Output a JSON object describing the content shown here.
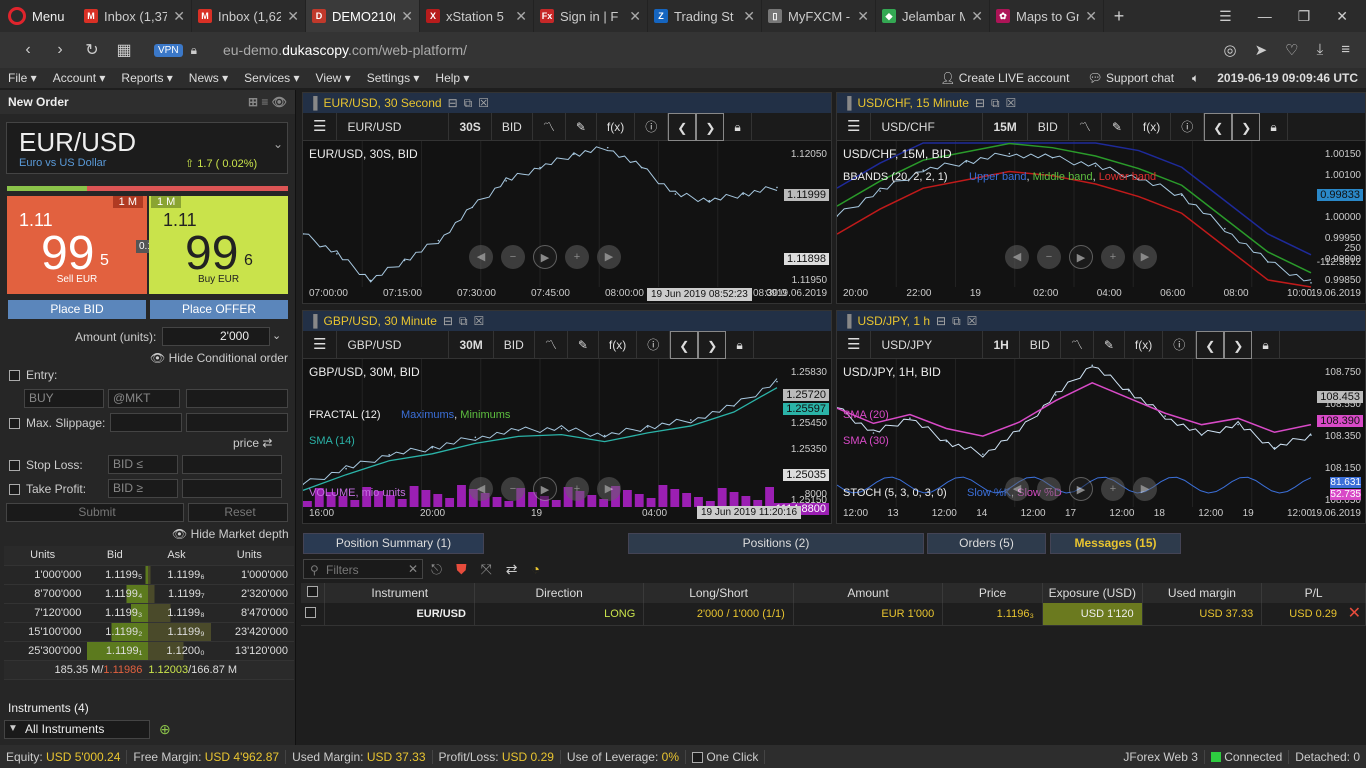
{
  "browser": {
    "menu_label": "Menu",
    "tabs": [
      {
        "title": "Inbox (1,37",
        "fav": "M",
        "color": "#d93025"
      },
      {
        "title": "Inbox (1,62",
        "fav": "M",
        "color": "#d93025"
      },
      {
        "title": "DEMO210(",
        "fav": "D",
        "color": "#c0392b"
      },
      {
        "title": "xStation 5",
        "fav": "X",
        "color": "#b71c1c"
      },
      {
        "title": "Sign in | F",
        "fav": "Fx",
        "color": "#c62828"
      },
      {
        "title": "Trading St",
        "fav": "Z",
        "color": "#1565c0"
      },
      {
        "title": "MyFXCM -",
        "fav": "▯",
        "color": "#777"
      },
      {
        "title": "Jelambar M",
        "fav": "◆",
        "color": "#34a853"
      },
      {
        "title": "Maps to Gr",
        "fav": "✿",
        "color": "#ad1457"
      }
    ],
    "vpn": "VPN",
    "url_prefix": "eu-demo.",
    "url_domain": "dukascopy",
    "url_suffix": ".com/web-platform/"
  },
  "platform_menu": {
    "items": [
      "File ▾",
      "Account ▾",
      "Reports ▾",
      "News ▾",
      "Services ▾",
      "View ▾",
      "Settings ▾",
      "Help ▾"
    ],
    "create_live": "Create LIVE account",
    "support_chat": "Support chat",
    "datetime": "2019-06-19 09:09:46 UTC"
  },
  "new_order": {
    "title": "New Order",
    "symbol": "EUR/USD",
    "symbol_desc": "Euro vs US Dollar",
    "change": "1.7 ( 0.02%)",
    "sell": {
      "big_prefix": "1.11",
      "big": "99",
      "pip": "5",
      "label": "Sell EUR",
      "amount": "1 M"
    },
    "buy": {
      "big_prefix": "1.11",
      "big": "99",
      "pip": "6",
      "label": "Buy EUR",
      "amount": "1 M"
    },
    "spread": "0.1",
    "place_bid": "Place BID",
    "place_offer": "Place OFFER",
    "amount_label": "Amount (units):",
    "amount_value": "2'000",
    "hide_conditional": "Hide Conditional order",
    "entry_label": "Entry:",
    "entry_side": "BUY",
    "entry_mkt": "@MKT",
    "max_slippage": "Max. Slippage:",
    "price_label": "price",
    "stop_loss": "Stop Loss:",
    "stop_loss_sel": "BID ≤",
    "take_profit": "Take Profit:",
    "take_profit_sel": "BID ≥",
    "submit": "Submit",
    "reset": "Reset",
    "hide_depth": "Hide Market depth"
  },
  "market_depth": {
    "headers": [
      "Units",
      "Bid",
      "Ask",
      "Units"
    ],
    "rows": [
      [
        "1'000'000",
        "1.1199₅",
        "1.1199₆",
        "1'000'000"
      ],
      [
        "8'700'000",
        "1.1199₄",
        "1.1199₇",
        "2'320'000"
      ],
      [
        "7'120'000",
        "1.1199₃",
        "1.1199₈",
        "8'470'000"
      ],
      [
        "15'100'000",
        "1.1199₂",
        "1.1199₉",
        "23'420'000"
      ],
      [
        "25'300'000",
        "1.1199₁",
        "1.1200₀",
        "13'120'000"
      ]
    ],
    "bid_levels": [
      0.04,
      0.35,
      0.28,
      0.6,
      1.0
    ],
    "ask_levels": [
      0.04,
      0.1,
      0.36,
      1.0,
      0.56
    ],
    "total_bid": "185.35 M/",
    "total_bid_px": "1.11986",
    "total_ask_px": "1.12003",
    "total_ask": "/166.87 M"
  },
  "instruments": {
    "title": "Instruments (4)",
    "filter": "All Instruments"
  },
  "charts": [
    {
      "title": "EUR/USD, 30 Second",
      "sym": "EUR/USD",
      "tf": "30S",
      "side": "BID",
      "label": "EUR/USD, 30S, BID",
      "yticks": [
        "1.12050",
        "1.11950"
      ],
      "last": "1.11999",
      "mark": "1.11898",
      "xticks": [
        "07:00:00",
        "07:15:00",
        "07:30:00",
        "07:45:00",
        "08:00:00",
        "08:15:00",
        "08:30:0"
      ],
      "cursor": "19 Jun 2019 08:52:23",
      "date": "0919.06.2019"
    },
    {
      "title": "USD/CHF, 15 Minute",
      "sym": "USD/CHF",
      "tf": "15M",
      "side": "BID",
      "label": "USD/CHF, 15M, BID",
      "ind": "BBANDS (20, 2, 2, 1)",
      "ind_u": "Upper band",
      "ind_m": "Middle band",
      "ind_l": "Lower band",
      "yticks": [
        "1.00150",
        "1.00100",
        "1.00050",
        "1.00000",
        "0.99950",
        "0.99900",
        "0.99850"
      ],
      "last": "0.99833",
      "osc": [
        "250",
        "-112.5812"
      ],
      "xticks": [
        "20:00",
        "22:00",
        "19",
        "02:00",
        "04:00",
        "06:00",
        "08:00",
        "10:00"
      ],
      "date": "19.06.2019"
    },
    {
      "title": "GBP/USD, 30 Minute",
      "sym": "GBP/USD",
      "tf": "30M",
      "side": "BID",
      "label": "GBP/USD, 30M, BID",
      "ind1": "FRACTAL (12)",
      "ind1b": "Maximums",
      "ind1c": "Minimums",
      "ind2": "SMA (14)",
      "ind3": "VOLUME, mio units",
      "yticks": [
        "1.25830",
        "1.25550",
        "1.25450",
        "1.25350",
        "1.25250",
        "1.25150"
      ],
      "last": "1.25720",
      "last2": "1.25597",
      "mark": "1.25035",
      "vol": [
        "8000",
        "6000"
      ],
      "vol_last": "1114.8800",
      "xticks": [
        "16:00",
        "20:00",
        "19",
        "04:00",
        "08:"
      ],
      "cursor": "19 Jun 2019 11:20:16"
    },
    {
      "title": "USD/JPY, 1 h",
      "sym": "USD/JPY",
      "tf": "1H",
      "side": "BID",
      "label": "USD/JPY, 1H, BID",
      "ind1": "SMA (20)",
      "ind2": "SMA (30)",
      "ind3": "STOCH (5, 3, 0, 3, 0)",
      "ind3a": "Slow %K",
      "ind3b": "Slow %D",
      "yticks": [
        "108.750",
        "108.550",
        "108.350",
        "108.150",
        "108.050"
      ],
      "last": "108.453",
      "last2": "108.390",
      "osc": [
        "81.631",
        "52.735"
      ],
      "xticks": [
        "12:00",
        "13",
        "12:00",
        "14",
        "12:00",
        "17",
        "12:00",
        "18",
        "12:00",
        "19",
        "12:00"
      ],
      "date": "19.06.2019"
    }
  ],
  "chart_data": [
    {
      "type": "line",
      "title": "EUR/USD, 30S, BID",
      "y": [
        1.1193,
        1.119,
        1.1186,
        1.1189,
        1.1192,
        1.1197,
        1.1201,
        1.1203,
        1.1205,
        1.1206,
        1.1203,
        1.1199,
        1.1198,
        1.1199,
        1.12
      ],
      "ylim": [
        1.1185,
        1.1207
      ]
    },
    {
      "type": "line",
      "title": "USD/CHF, 15M, BID",
      "y": [
        0.9999,
        1.0005,
        1.001,
        1.0012,
        1.0014,
        1.0013,
        1.0011,
        1.0008,
        1.0004,
        0.9996,
        0.9988,
        0.9983
      ],
      "ylim": [
        0.9982,
        1.0017
      ]
    },
    {
      "type": "line",
      "title": "GBP/USD, 30M, BID",
      "y": [
        1.2513,
        1.2522,
        1.253,
        1.2534,
        1.254,
        1.2544,
        1.2545,
        1.2541,
        1.2546,
        1.255,
        1.2558,
        1.2572
      ],
      "ylim": [
        1.25,
        1.2585
      ]
    },
    {
      "type": "line",
      "title": "USD/JPY, 1H, BID",
      "y": [
        108.52,
        108.4,
        108.47,
        108.36,
        108.3,
        108.41,
        108.58,
        108.72,
        108.6,
        108.48,
        108.39,
        108.44,
        108.33,
        108.39
      ],
      "ylim": [
        108.05,
        108.75
      ]
    }
  ],
  "bottom": {
    "tabs": [
      "Position Summary (1)",
      "Positions (2)",
      "Orders (5)",
      "Messages (15)"
    ],
    "filter_placeholder": "Filters",
    "headers": [
      "Instrument",
      "Direction",
      "Long/Short",
      "Amount",
      "Price",
      "Exposure (USD)",
      "Used margin",
      "P/L"
    ],
    "row": {
      "instrument": "EUR/USD",
      "direction": "LONG",
      "long_short": "2'000 / 1'000 (1/1)",
      "amount": "EUR 1'000",
      "price": "1.1196₃",
      "exposure": "USD 1'120",
      "margin": "USD 37.33",
      "pl": "USD 0.29"
    }
  },
  "status": {
    "equity_l": "Equity:",
    "equity": "USD 5'000.24",
    "free_l": "Free Margin:",
    "free": "USD 4'962.87",
    "used_l": "Used Margin:",
    "used": "USD 37.33",
    "pl_l": "Profit/Loss:",
    "pl": "USD 0.29",
    "lev_l": "Use of Leverage:",
    "lev": "0%",
    "one_click": "One Click",
    "version": "JForex Web 3",
    "connected": "Connected",
    "detached": "Detached: 0"
  }
}
